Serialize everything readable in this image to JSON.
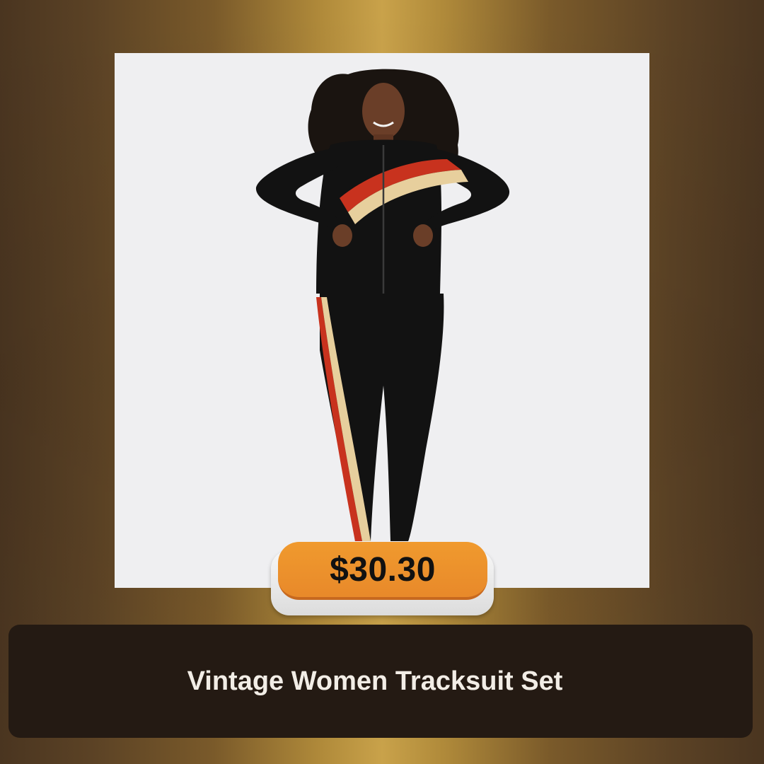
{
  "product": {
    "price": "$30.30",
    "title": "Vintage Women Tracksuit Set",
    "image_subject": "woman-in-black-tracksuit-with-red-and-beige-stripes"
  },
  "colors": {
    "card_background": "#efeff1",
    "price_pill": "#e8892a",
    "title_bar": "#241a13",
    "title_text": "#f2ede6",
    "tracksuit": "#121212",
    "stripe_red": "#c8321e",
    "stripe_beige": "#e7cf9d"
  }
}
